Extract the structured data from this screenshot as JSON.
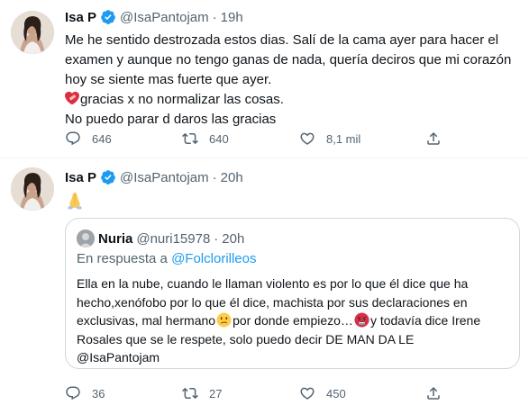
{
  "tweets": [
    {
      "author_name": "Isa P",
      "handle": "@IsaPantojam",
      "separator": "·",
      "time": "19h",
      "lines": [
        "Me he sentido destrozada estos dias. Salí de la cama ayer para hacer el",
        "examen y aunque no tengo ganas de nada, quería deciros que mi corazón",
        "hoy se siente mas fuerte que ayer.",
        "gracias x no normalizar las cosas.",
        "No puedo parar d daros las gracias"
      ],
      "emoji": "heart-with-bandage-icon",
      "replies": "646",
      "retweets": "640",
      "likes": "8,1 mil"
    },
    {
      "author_name": "Isa P",
      "handle": "@IsaPantojam",
      "separator": "·",
      "time": "20h",
      "emoji": "folded-hands-icon",
      "replies": "36",
      "retweets": "27",
      "likes": "450",
      "quote": {
        "name": "Nuria",
        "handle": "@nuri15978",
        "separator": "·",
        "time": "20h",
        "reply_prefix": "En respuesta a",
        "reply_to": "@Folclorilleos",
        "line1": "Ella en la nube, cuando le llaman violento es por lo que él dice que ha",
        "line2": "hecho,xenófobo por lo que él dice, machista por sus declaraciones en",
        "line3a": "exclusivas, mal hermano",
        "line3b": "por donde empiezo…",
        "line3c": "y todavía dice Irene",
        "line4": "Rosales que se le respete, solo puedo decir DE MAN DA LE",
        "line5": "@IsaPantojam",
        "emoji_1": "confused-face-icon",
        "emoji_2": "angry-face-icon"
      }
    }
  ],
  "colors": {
    "text": "#0f1419",
    "secondary": "#536471",
    "accent": "#1d9bf0",
    "border": "#cfd9de",
    "divider": "#eff3f4"
  }
}
